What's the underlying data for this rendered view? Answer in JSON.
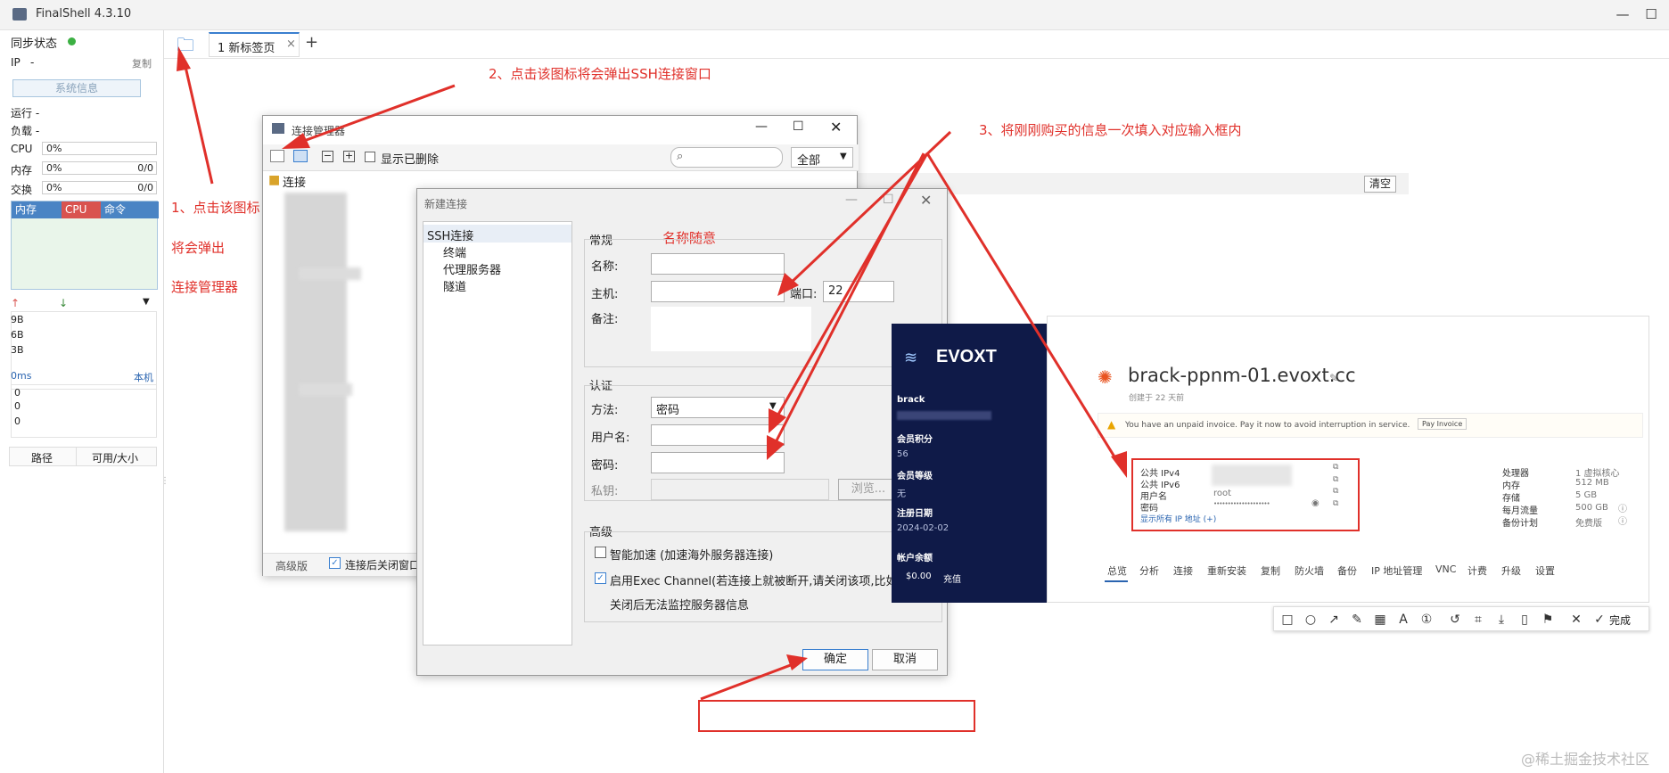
{
  "app": {
    "title": "FinalShell 4.3.10"
  },
  "sidebar": {
    "sync_label": "同步状态",
    "ip_label": "IP",
    "ip_value": "-",
    "copy_label": "复制",
    "sysinfo_button": "系统信息",
    "run_label": "运行 -",
    "load_label": "负载 -",
    "cpu_label": "CPU",
    "cpu_value": "0%",
    "mem_label": "内存",
    "mem_value": "0%",
    "mem_right": "0/0",
    "swap_label": "交换",
    "swap_value": "0%",
    "swap_right": "0/0",
    "tab_mem": "内存",
    "tab_cpu": "CPU",
    "tab_cmd": "命令",
    "net_ticks": [
      "9B",
      "6B",
      "3B"
    ],
    "latency_label": "0ms",
    "local_label": "本机",
    "lat_vals": [
      "0",
      "0",
      "0"
    ],
    "path_label": "路径",
    "avail_label": "可用/大小"
  },
  "tabbar": {
    "tab1_label": "1 新标签页",
    "clear_label": "清空"
  },
  "annotations": {
    "a1_line1": "1、点击该图标",
    "a1_line2": "将会弹出",
    "a1_line3": "连接管理器",
    "a2": "2、点击该图标将会弹出SSH连接窗口",
    "a3": "3、将刚刚购买的信息一次填入对应输入框内",
    "name_any": "名称随意"
  },
  "conn_manager": {
    "title": "连接管理器",
    "show_deleted": "显示已删除",
    "filter_value": "全部",
    "tree_root": "连接",
    "advanced": "高级版",
    "close_after": "连接后关闭窗口"
  },
  "new_conn": {
    "title": "新建连接",
    "tree": [
      "SSH连接",
      "终端",
      "代理服务器",
      "隧道"
    ],
    "general": "常规",
    "name_label": "名称:",
    "host_label": "主机:",
    "port_label": "端口:",
    "port_value": "22",
    "note_label": "备注:",
    "auth": "认证",
    "method_label": "方法:",
    "method_value": "密码",
    "user_label": "用户名:",
    "pass_label": "密码:",
    "key_label": "私钥:",
    "browse": "浏览...",
    "advanced": "高级",
    "smart_accel": "智能加速 (加速海外服务器连接)",
    "exec_channel": "启用Exec Channel(若连接上就被断开,请关闭该项,比如",
    "exec_channel2": "关闭后无法监控服务器信息",
    "ok": "确定",
    "cancel": "取消"
  },
  "evoxt": {
    "brand": "EVOXT",
    "user": "brack",
    "points_label": "会员积分",
    "points_value": "56",
    "level_label": "会员等级",
    "level_value": "无",
    "reg_label": "注册日期",
    "reg_value": "2024-02-02",
    "balance_label": "帐户余额",
    "balance_value": "$0.00",
    "recharge": "充值",
    "server_name": "brack-ppnm-01.evoxt.cc",
    "created": "创建于 22 天前",
    "invoice_notice": "You have an unpaid invoice. Pay it now to avoid interruption in service.",
    "pay_button": "Pay Invoice",
    "ipv4_label": "公共 IPv4",
    "ipv6_label": "公共 IPv6",
    "username_label": "用户名",
    "username_value": "root",
    "password_label": "密码",
    "password_value": "••••••••••••••••••••",
    "show_all_ip": "显示所有 IP 地址 (+)",
    "specs": [
      {
        "k": "处理器",
        "v": "1 虚拟核心"
      },
      {
        "k": "内存",
        "v": "512 MB"
      },
      {
        "k": "存储",
        "v": "5 GB"
      },
      {
        "k": "每月流量",
        "v": "500 GB"
      },
      {
        "k": "备份计划",
        "v": "免费版"
      }
    ],
    "tabs": [
      "总览",
      "分析",
      "连接",
      "重新安装",
      "复制",
      "防火墙",
      "备份",
      "IP 地址管理",
      "VNC",
      "计费",
      "升级",
      "设置"
    ]
  },
  "screenshot_toolbar": {
    "done": "完成"
  },
  "watermark": "@稀土掘金技术社区",
  "colors": {
    "accent_red": "#e0302a",
    "evoxt_navy": "#0f1a48",
    "status_green": "#3cb043"
  }
}
